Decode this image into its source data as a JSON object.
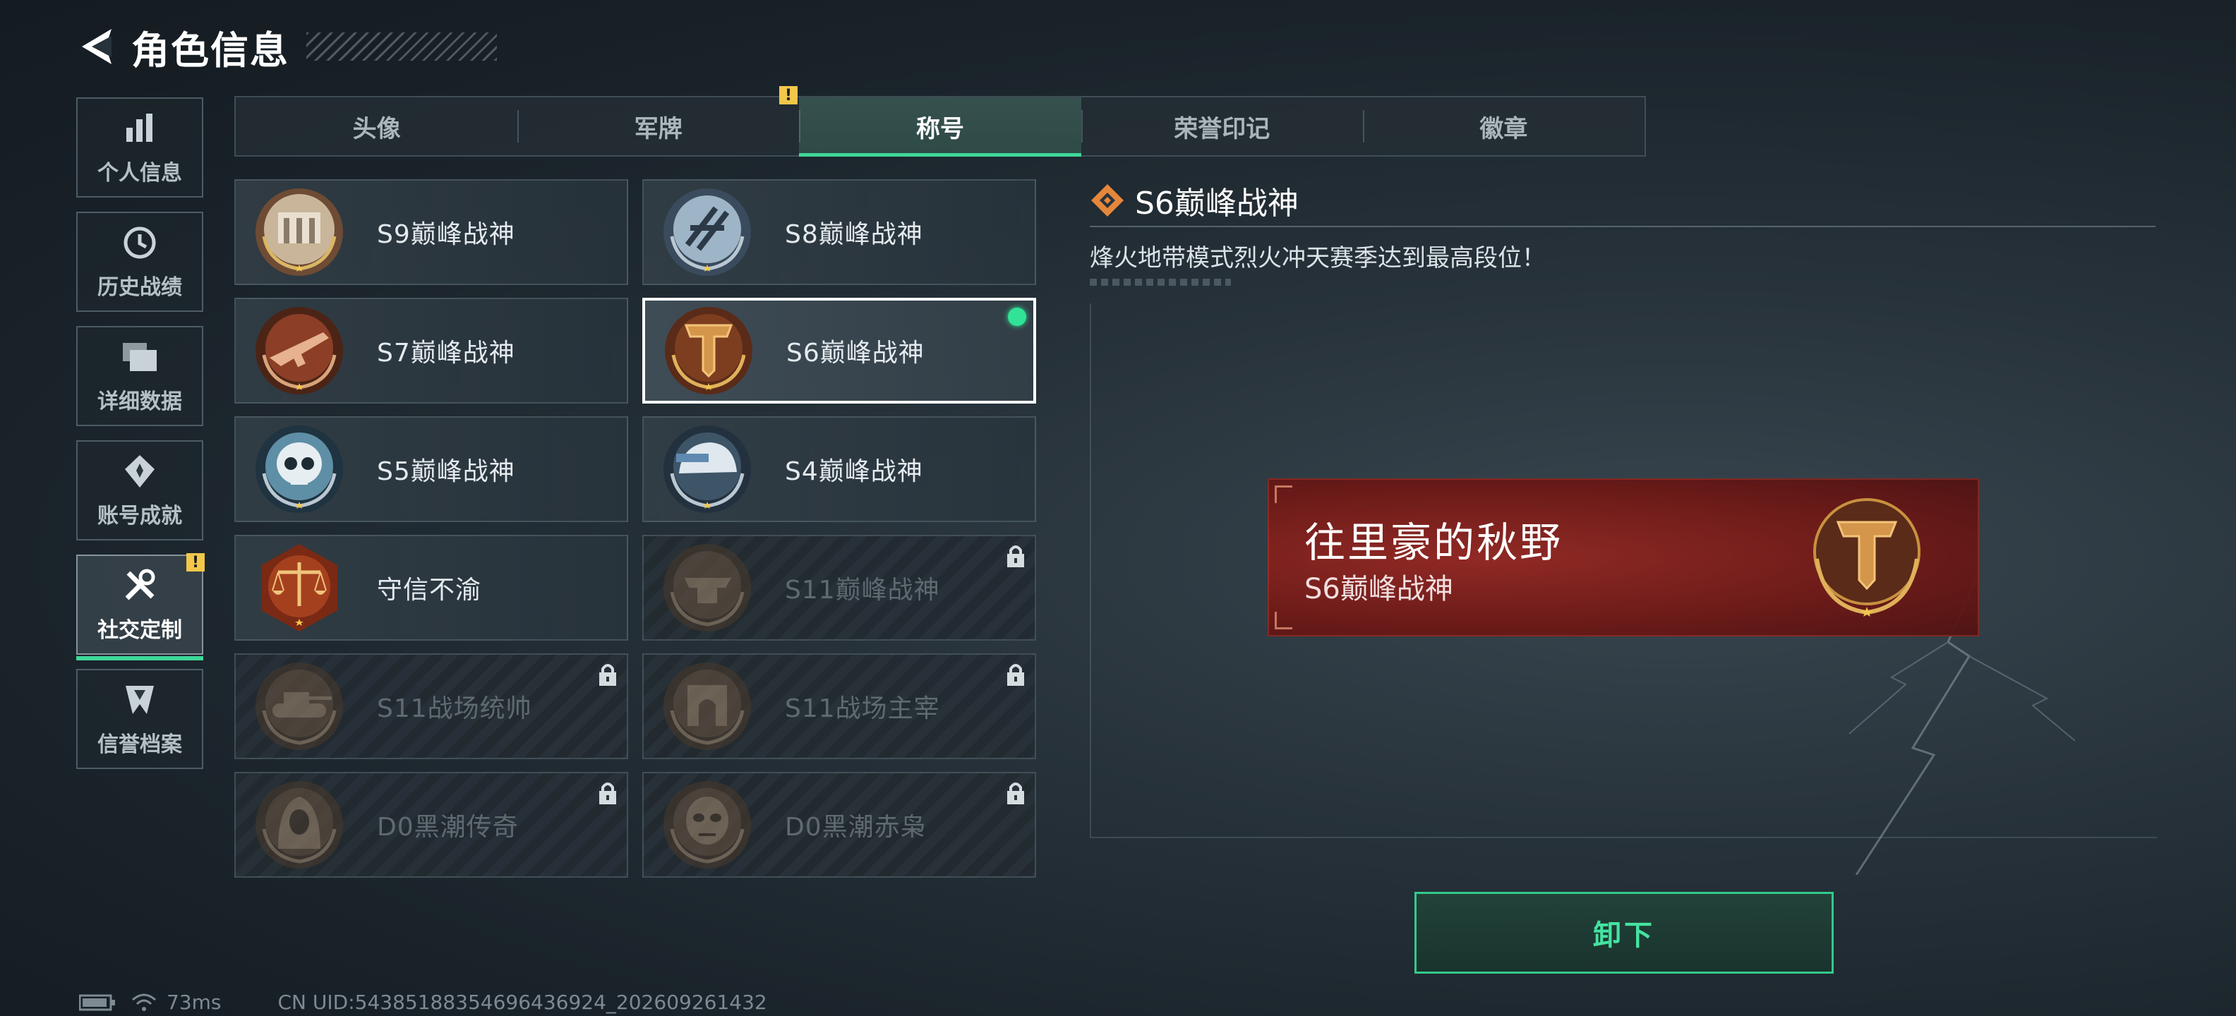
{
  "header": {
    "title": "角色信息"
  },
  "sidebar": {
    "items": [
      {
        "label": "个人信息",
        "icon": "bar-chart-icon"
      },
      {
        "label": "历史战绩",
        "icon": "history-icon"
      },
      {
        "label": "详细数据",
        "icon": "folder-icon"
      },
      {
        "label": "账号成就",
        "icon": "achievement-icon"
      },
      {
        "label": "社交定制",
        "icon": "wrench-icon",
        "active": true,
        "badge": "!"
      },
      {
        "label": "信誉档案",
        "icon": "shield-icon"
      }
    ]
  },
  "tabs": [
    {
      "label": "头像"
    },
    {
      "label": "军牌",
      "badge": "!"
    },
    {
      "label": "称号",
      "active": true
    },
    {
      "label": "荣誉印记"
    },
    {
      "label": "徽章"
    }
  ],
  "titles": [
    {
      "label": "S9巅峰战神",
      "emblem": "fortress-emblem",
      "locked": false
    },
    {
      "label": "S8巅峰战神",
      "emblem": "slash-emblem",
      "locked": false
    },
    {
      "label": "S7巅峰战神",
      "emblem": "rifle-emblem",
      "locked": false
    },
    {
      "label": "S6巅峰战神",
      "emblem": "t-shield-emblem",
      "locked": false,
      "selected": true,
      "equipped": true
    },
    {
      "label": "S5巅峰战神",
      "emblem": "skull-emblem",
      "locked": false
    },
    {
      "label": "S4巅峰战神",
      "emblem": "helmet-emblem",
      "locked": false
    },
    {
      "label": "守信不渝",
      "emblem": "scales-emblem",
      "locked": false
    },
    {
      "label": "S11巅峰战神",
      "emblem": "anvil-emblem",
      "locked": true
    },
    {
      "label": "S11战场统帅",
      "emblem": "tank-emblem",
      "locked": true
    },
    {
      "label": "S11战场主宰",
      "emblem": "arch-emblem",
      "locked": true
    },
    {
      "label": "D0黑潮传奇",
      "emblem": "hooded-emblem",
      "locked": true
    },
    {
      "label": "D0黑潮赤枭",
      "emblem": "mask-emblem",
      "locked": true
    }
  ],
  "detail": {
    "title": "S6巅峰战神",
    "description": "烽火地带模式烈火冲天赛季达到最高段位！"
  },
  "preview": {
    "player_name": "往里豪的秋野",
    "title": "S6巅峰战神"
  },
  "actions": {
    "unequip_label": "卸下"
  },
  "status": {
    "ping": "73ms",
    "uid": "CN UID:5438518835469643692​4_202609261432"
  },
  "colors": {
    "accent": "#3fd79a",
    "badge": "#f2c74a",
    "plate": "#8c1f1b",
    "emblem_gold": "#c8913f"
  }
}
